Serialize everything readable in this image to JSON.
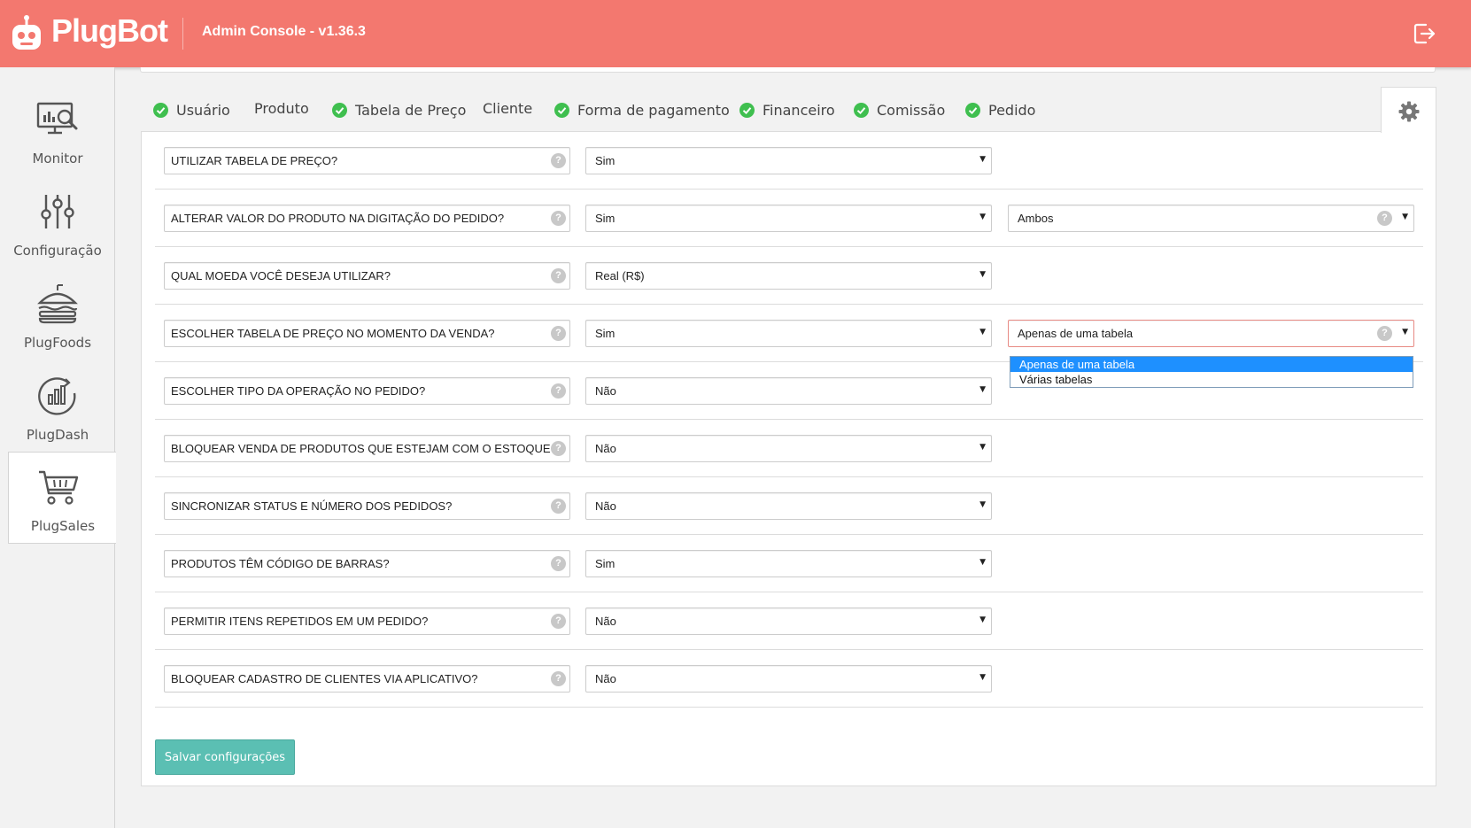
{
  "header": {
    "brand": "PlugBot",
    "console_title": "Admin Console - v1.36.3",
    "brand_color": "#f3786f",
    "logout_icon": "logout-icon"
  },
  "sidebar": {
    "items": [
      {
        "label": "Monitor",
        "icon": "monitor-chart-icon",
        "active": false
      },
      {
        "label": "Configuração",
        "icon": "sliders-icon",
        "active": false
      },
      {
        "label": "PlugFoods",
        "icon": "burger-icon",
        "active": false
      },
      {
        "label": "PlugDash",
        "icon": "dashboard-chart-icon",
        "active": false
      },
      {
        "label": "PlugSales",
        "icon": "shopping-cart-icon",
        "active": true
      }
    ]
  },
  "tabs": [
    {
      "label": "Usuário",
      "checked": true
    },
    {
      "label": "Produto",
      "checked": false
    },
    {
      "label": "Tabela de Preço",
      "checked": true
    },
    {
      "label": "Cliente",
      "checked": false
    },
    {
      "label": "Forma de pagamento",
      "checked": true
    },
    {
      "label": "Financeiro",
      "checked": true
    },
    {
      "label": "Comissão",
      "checked": true
    },
    {
      "label": "Pedido",
      "checked": true
    }
  ],
  "settings_icon": "gear-icon",
  "rows": [
    {
      "question": "UTILIZAR TABELA DE PREÇO?",
      "value": "Sim"
    },
    {
      "question": "ALTERAR VALOR DO PRODUTO NA DIGITAÇÃO DO PEDIDO?",
      "value": "Sim",
      "extra": "Ambos"
    },
    {
      "question": "QUAL MOEDA VOCÊ DESEJA UTILIZAR?",
      "value": "Real (R$)"
    },
    {
      "question": "ESCOLHER TABELA DE PREÇO NO MOMENTO DA VENDA?",
      "value": "Sim",
      "extra": "Apenas de uma tabela"
    },
    {
      "question": "ESCOLHER TIPO DA OPERAÇÃO NO PEDIDO?",
      "value": "Não"
    },
    {
      "question": "BLOQUEAR VENDA DE PRODUTOS QUE ESTEJAM COM O ESTOQUE",
      "value": "Não"
    },
    {
      "question": "SINCRONIZAR STATUS E NÚMERO DOS PEDIDOS?",
      "value": "Não"
    },
    {
      "question": "PRODUTOS TÊM CÓDIGO DE BARRAS?",
      "value": "Sim"
    },
    {
      "question": "PERMITIR ITENS REPETIDOS EM UM PEDIDO?",
      "value": "Não"
    },
    {
      "question": "BLOQUEAR CADASTRO DE CLIENTES VIA APLICATIVO?",
      "value": "Não"
    }
  ],
  "open_dropdown": {
    "options": [
      "Apenas de uma tabela",
      "Várias tabelas"
    ],
    "selected": "Apenas de uma tabela"
  },
  "save_button": "Salvar configurações",
  "help_glyph": "?",
  "arrow_glyph": "▼"
}
